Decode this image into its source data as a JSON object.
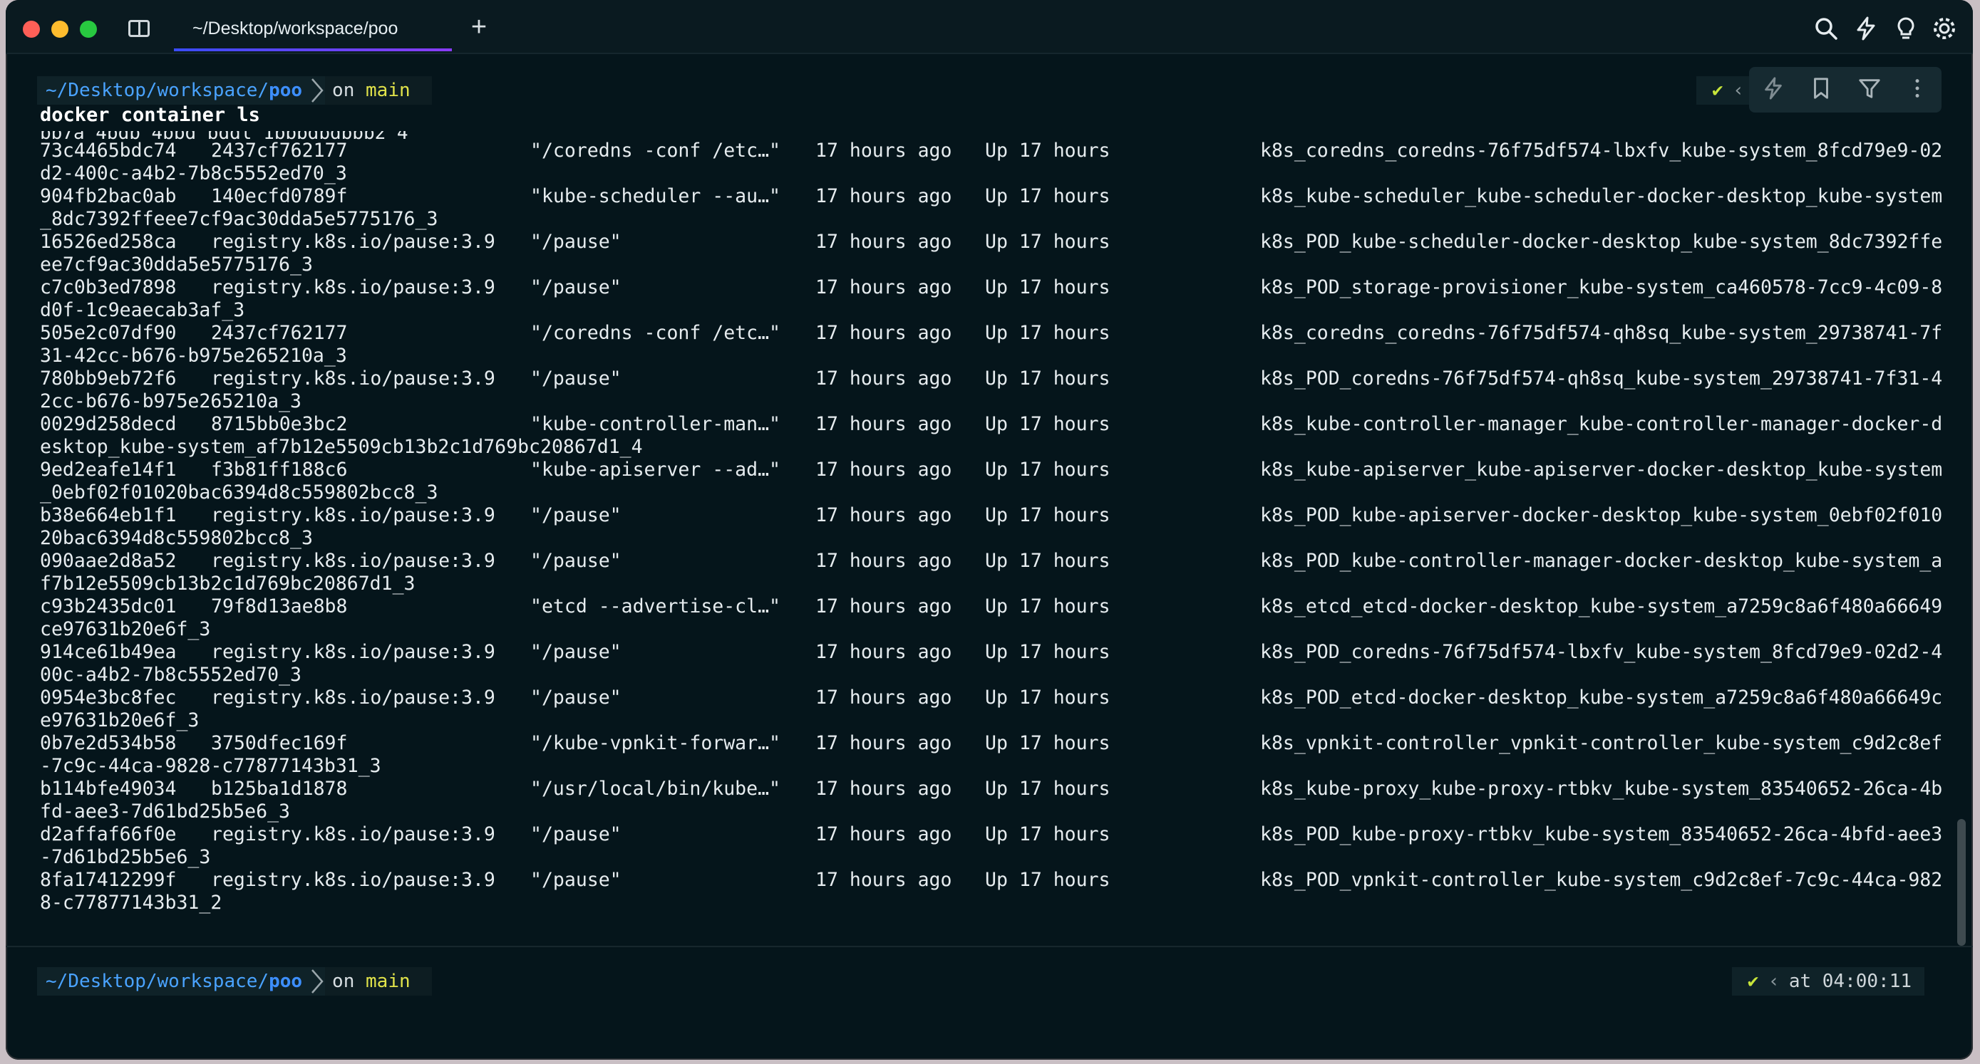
{
  "tab": {
    "title": "~/Desktop/workspace/poo"
  },
  "prompt1": {
    "path_prefix": "~/Desktop/workspace/",
    "path_dir": "poo",
    "on": "on",
    "branch": "main"
  },
  "right_prompt1": {
    "check": "✔"
  },
  "command": "docker container ls",
  "clipped_line": "bb7a 4bdb 4bbd bddl_1bbbdbdbbb2_4",
  "rows": [
    {
      "id": "73c4465bdc74",
      "image": "2437cf762177",
      "command": "\"/coredns -conf /etc…\"",
      "created": "17 hours ago",
      "status": "Up 17 hours",
      "name": "k8s_coredns_coredns-76f75df574-lbxfv_kube-system_8fcd79e9-02",
      "cont": "d2-400c-a4b2-7b8c5552ed70_3"
    },
    {
      "id": "904fb2bac0ab",
      "image": "140ecfd0789f",
      "command": "\"kube-scheduler --au…\"",
      "created": "17 hours ago",
      "status": "Up 17 hours",
      "name": "k8s_kube-scheduler_kube-scheduler-docker-desktop_kube-system",
      "cont": "_8dc7392ffeee7cf9ac30dda5e5775176_3"
    },
    {
      "id": "16526ed258ca",
      "image": "registry.k8s.io/pause:3.9",
      "command": "\"/pause\"",
      "created": "17 hours ago",
      "status": "Up 17 hours",
      "name": "k8s_POD_kube-scheduler-docker-desktop_kube-system_8dc7392ffe",
      "cont": "ee7cf9ac30dda5e5775176_3"
    },
    {
      "id": "c7c0b3ed7898",
      "image": "registry.k8s.io/pause:3.9",
      "command": "\"/pause\"",
      "created": "17 hours ago",
      "status": "Up 17 hours",
      "name": "k8s_POD_storage-provisioner_kube-system_ca460578-7cc9-4c09-8",
      "cont": "d0f-1c9eaecab3af_3"
    },
    {
      "id": "505e2c07df90",
      "image": "2437cf762177",
      "command": "\"/coredns -conf /etc…\"",
      "created": "17 hours ago",
      "status": "Up 17 hours",
      "name": "k8s_coredns_coredns-76f75df574-qh8sq_kube-system_29738741-7f",
      "cont": "31-42cc-b676-b975e265210a_3"
    },
    {
      "id": "780bb9eb72f6",
      "image": "registry.k8s.io/pause:3.9",
      "command": "\"/pause\"",
      "created": "17 hours ago",
      "status": "Up 17 hours",
      "name": "k8s_POD_coredns-76f75df574-qh8sq_kube-system_29738741-7f31-4",
      "cont": "2cc-b676-b975e265210a_3"
    },
    {
      "id": "0029d258decd",
      "image": "8715bb0e3bc2",
      "command": "\"kube-controller-man…\"",
      "created": "17 hours ago",
      "status": "Up 17 hours",
      "name": "k8s_kube-controller-manager_kube-controller-manager-docker-d",
      "cont": "esktop_kube-system_af7b12e5509cb13b2c1d769bc20867d1_4"
    },
    {
      "id": "9ed2eafe14f1",
      "image": "f3b81ff188c6",
      "command": "\"kube-apiserver --ad…\"",
      "created": "17 hours ago",
      "status": "Up 17 hours",
      "name": "k8s_kube-apiserver_kube-apiserver-docker-desktop_kube-system",
      "cont": "_0ebf02f01020bac6394d8c559802bcc8_3"
    },
    {
      "id": "b38e664eb1f1",
      "image": "registry.k8s.io/pause:3.9",
      "command": "\"/pause\"",
      "created": "17 hours ago",
      "status": "Up 17 hours",
      "name": "k8s_POD_kube-apiserver-docker-desktop_kube-system_0ebf02f010",
      "cont": "20bac6394d8c559802bcc8_3"
    },
    {
      "id": "090aae2d8a52",
      "image": "registry.k8s.io/pause:3.9",
      "command": "\"/pause\"",
      "created": "17 hours ago",
      "status": "Up 17 hours",
      "name": "k8s_POD_kube-controller-manager-docker-desktop_kube-system_a",
      "cont": "f7b12e5509cb13b2c1d769bc20867d1_3"
    },
    {
      "id": "c93b2435dc01",
      "image": "79f8d13ae8b8",
      "command": "\"etcd --advertise-cl…\"",
      "created": "17 hours ago",
      "status": "Up 17 hours",
      "name": "k8s_etcd_etcd-docker-desktop_kube-system_a7259c8a6f480a66649",
      "cont": "ce97631b20e6f_3"
    },
    {
      "id": "914ce61b49ea",
      "image": "registry.k8s.io/pause:3.9",
      "command": "\"/pause\"",
      "created": "17 hours ago",
      "status": "Up 17 hours",
      "name": "k8s_POD_coredns-76f75df574-lbxfv_kube-system_8fcd79e9-02d2-4",
      "cont": "00c-a4b2-7b8c5552ed70_3"
    },
    {
      "id": "0954e3bc8fec",
      "image": "registry.k8s.io/pause:3.9",
      "command": "\"/pause\"",
      "created": "17 hours ago",
      "status": "Up 17 hours",
      "name": "k8s_POD_etcd-docker-desktop_kube-system_a7259c8a6f480a66649c",
      "cont": "e97631b20e6f_3"
    },
    {
      "id": "0b7e2d534b58",
      "image": "3750dfec169f",
      "command": "\"/kube-vpnkit-forwar…\"",
      "created": "17 hours ago",
      "status": "Up 17 hours",
      "name": "k8s_vpnkit-controller_vpnkit-controller_kube-system_c9d2c8ef",
      "cont": "-7c9c-44ca-9828-c77877143b31_3"
    },
    {
      "id": "b114bfe49034",
      "image": "b125ba1d1878",
      "command": "\"/usr/local/bin/kube…\"",
      "created": "17 hours ago",
      "status": "Up 17 hours",
      "name": "k8s_kube-proxy_kube-proxy-rtbkv_kube-system_83540652-26ca-4b",
      "cont": "fd-aee3-7d61bd25b5e6_3"
    },
    {
      "id": "d2affaf66f0e",
      "image": "registry.k8s.io/pause:3.9",
      "command": "\"/pause\"",
      "created": "17 hours ago",
      "status": "Up 17 hours",
      "name": "k8s_POD_kube-proxy-rtbkv_kube-system_83540652-26ca-4bfd-aee3",
      "cont": "-7d61bd25b5e6_3"
    },
    {
      "id": "8fa17412299f",
      "image": "registry.k8s.io/pause:3.9",
      "command": "\"/pause\"",
      "created": "17 hours ago",
      "status": "Up 17 hours",
      "name": "k8s_POD_vpnkit-controller_kube-system_c9d2c8ef-7c9c-44ca-982",
      "cont": "8-c77877143b31_2"
    }
  ],
  "prompt2": {
    "path_prefix": "~/Desktop/workspace/",
    "path_dir": "poo",
    "on": "on",
    "branch": "main"
  },
  "right_prompt2": {
    "check": "✔",
    "time": "at 04:00:11"
  },
  "icons": [
    "panel-icon",
    "new-tab-icon",
    "search-icon",
    "bolt-icon",
    "lightbulb-icon",
    "gear-icon",
    "bookmark-icon",
    "filter-icon",
    "more-vertical-icon"
  ],
  "colors": {
    "background": "#05151b",
    "path": "#3d8fff",
    "branch": "#e1e34a",
    "check": "#c7e53a",
    "tab_accent": "#8a3cff"
  }
}
